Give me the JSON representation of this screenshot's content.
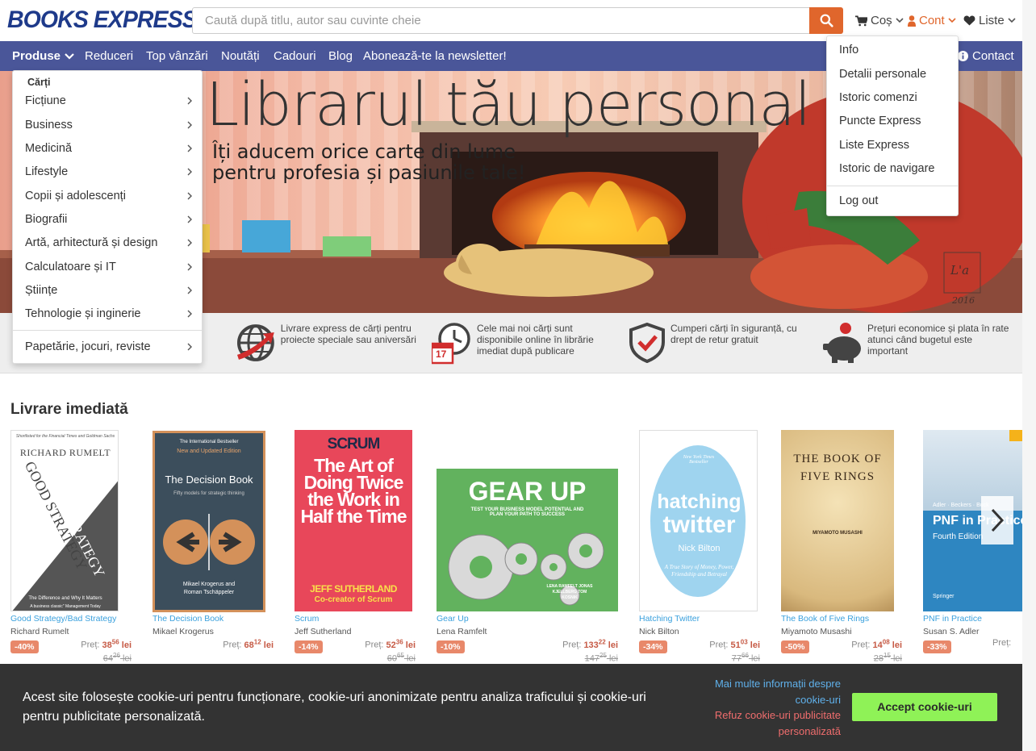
{
  "header": {
    "logo": "BOOKS EXPRESS",
    "search_placeholder": "Caută după titlu, autor sau cuvinte cheie",
    "cart_label": "Coș",
    "account_label": "Cont",
    "lists_label": "Liste"
  },
  "nav": {
    "products": "Produse",
    "items": [
      "Reduceri",
      "Top vânzări",
      "Noutăți",
      "Cadouri",
      "Blog",
      "Abonează-te la newsletter!"
    ],
    "contact": "Contact"
  },
  "product_menu": {
    "heading": "Cărți",
    "items": [
      "Ficțiune",
      "Business",
      "Medicină",
      "Lifestyle",
      "Copii și adolescenți",
      "Biografii",
      "Artă, arhitectură și design",
      "Calculatoare și IT",
      "Științe",
      "Tehnologie și inginerie"
    ],
    "extra": "Papetărie, jocuri, reviste"
  },
  "account_menu": {
    "items": [
      "Info",
      "Detalii personale",
      "Istoric comenzi",
      "Puncte Express",
      "Liste Express",
      "Istoric de navigare"
    ],
    "logout": "Log out"
  },
  "hero": {
    "title": "Librarul tău personal",
    "line1": "Îți aducem orice carte din lume",
    "line2": "pentru profesia și pasiunile tale!",
    "signature": "L'a",
    "year": "2016"
  },
  "features": [
    "Livrare express de cărți pentru proiecte speciale sau aniversări",
    "Cele mai noi cărți sunt disponibile online în librărie imediat după publicare",
    "Cumperi cărți în siguranță, cu drept de retur gratuit",
    "Prețuri economice și plata în rate atunci când bugetul este important"
  ],
  "calendar_day": "17",
  "section_title": "Livrare imediată",
  "price_label": "Preț:",
  "currency": "lei",
  "books": [
    {
      "title": "Good Strategy/Bad Strategy",
      "author": "Richard Rumelt",
      "discount": "-40%",
      "price_int": "38",
      "price_dec": "56",
      "old_int": "64",
      "old_dec": "26",
      "cover": {
        "top": "Shortlisted for the Financial Times and Goldman Sachs",
        "author": "RICHARD RUMELT",
        "t1": "GOOD STRATEGY",
        "t2": "BAD STRATEGY",
        "sub": "The Difference and Why It Matters",
        "quote": "A business classic\" Management Today"
      }
    },
    {
      "title": "The Decision Book",
      "author": "Mikael Krogerus",
      "discount": "",
      "price_int": "68",
      "price_dec": "12",
      "old_int": "",
      "old_dec": "",
      "cover": {
        "top": "The International Bestseller",
        "edition": "New and Updated Edition",
        "t1": "The Decision Book",
        "sub": "Fifty models for strategic thinking",
        "authors": "Mikael Krogerus and Roman Tschäppeler"
      }
    },
    {
      "title": "Scrum",
      "author": "Jeff Sutherland",
      "discount": "-14%",
      "price_int": "52",
      "price_dec": "36",
      "old_int": "60",
      "old_dec": "65",
      "cover": {
        "t0": "SCRUM",
        "t1": "The Art of Doing Twice the Work in Half the Time",
        "author": "JEFF SUTHERLAND",
        "sub": "Co-creator of Scrum"
      }
    },
    {
      "title": "Gear Up",
      "author": "Lena Ramfelt",
      "discount": "-10%",
      "price_int": "133",
      "price_dec": "22",
      "old_int": "147",
      "old_dec": "25",
      "cover": {
        "t1": "GEAR UP",
        "sub": "TEST YOUR BUSINESS MODEL POTENTIAL AND PLAN YOUR PATH TO SUCCESS",
        "authors": "LENA RAMFELT JONAS KJELLBERG TOM KOSNIK"
      }
    },
    {
      "title": "Hatching Twitter",
      "author": "Nick Bilton",
      "discount": "-34%",
      "price_int": "51",
      "price_dec": "03",
      "old_int": "77",
      "old_dec": "66",
      "cover": {
        "top": "New York Times Bestseller",
        "t1": "hatching",
        "t2": "twitter",
        "author": "Nick Bilton",
        "sub": "A True Story of Money, Power, Friendship and Betrayal"
      }
    },
    {
      "title": "The Book of Five Rings",
      "author": "Miyamoto Musashi",
      "discount": "-50%",
      "price_int": "14",
      "price_dec": "08",
      "old_int": "28",
      "old_dec": "15",
      "cover": {
        "t1": "THE BOOK OF FIVE RINGS",
        "author": "MIYAMOTO MUSASHI"
      }
    },
    {
      "title": "PNF in Practice",
      "author": "Susan S. Adler",
      "discount": "-33%",
      "price_int": "",
      "price_dec": "",
      "old_int": "",
      "old_dec": "",
      "cover": {
        "authors": "Adler · Beckers · Buck",
        "t1": "PNF in Practice",
        "sub": "Fourth Edition",
        "publisher": "Springer"
      }
    }
  ],
  "cookie": {
    "text": "Acest site folosește cookie-uri pentru funcționare, cookie-uri anonimizate pentru analiza traficului și cookie-uri pentru publicitate personalizată.",
    "more_info": "Mai multe informații despre cookie-uri",
    "refuse": "Refuz cookie-uri publicitate personalizată",
    "accept": "Accept cookie-uri"
  }
}
